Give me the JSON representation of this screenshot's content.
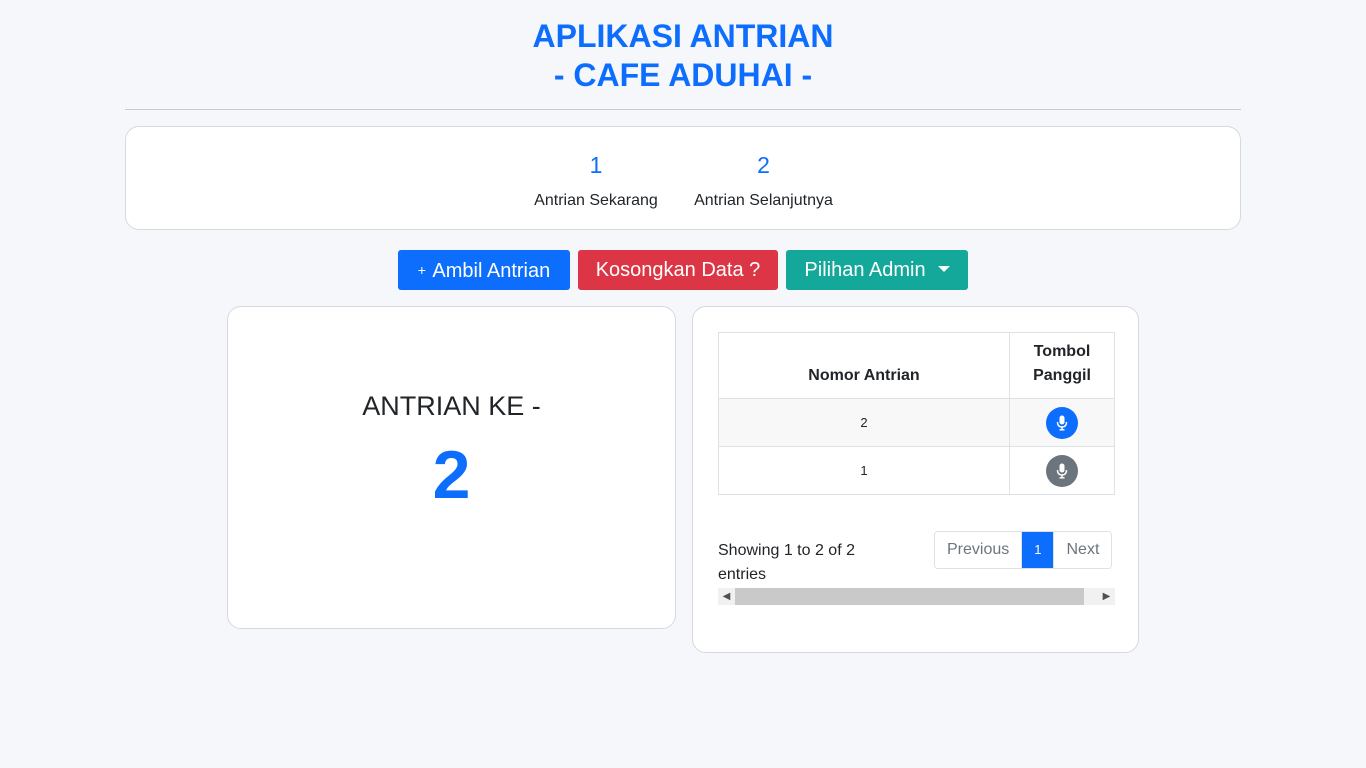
{
  "header": {
    "title_line1": "APLIKASI ANTRIAN",
    "title_line2": "- CAFE ADUHAI -"
  },
  "stats": {
    "current_value": "1",
    "current_label": "Antrian Sekarang",
    "next_value": "2",
    "next_label": "Antrian Selanjutnya"
  },
  "buttons": {
    "take_plus": "+",
    "take_label": "Ambil Antrian",
    "clear_label": "Kosongkan Data ?",
    "admin_label": "Pilihan Admin"
  },
  "display": {
    "label": "ANTRIAN KE -",
    "number": "2"
  },
  "table": {
    "col1": "Nomor Antrian",
    "col2_line1": "Tombol",
    "col2_line2": "Panggil",
    "rows": [
      {
        "number": "2",
        "mic_color": "#0d6efd",
        "icon": "microphone-icon"
      },
      {
        "number": "1",
        "mic_color": "#6c757d",
        "icon": "microphone-icon"
      }
    ]
  },
  "footer": {
    "info": "Showing 1 to 2 of 2 entries",
    "prev": "Previous",
    "page": "1",
    "next": "Next"
  },
  "colors": {
    "primary": "#0d6efd",
    "danger": "#dc3545",
    "teal": "#14a89b",
    "secondary": "#6c757d"
  }
}
